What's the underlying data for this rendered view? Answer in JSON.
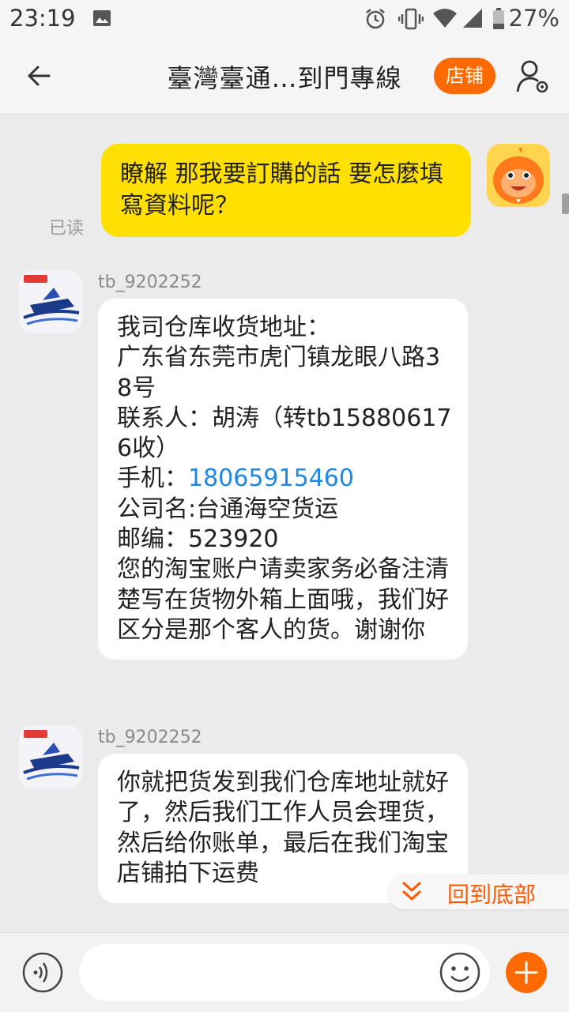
{
  "status_bar": {
    "time": "23:19",
    "battery": "27%",
    "icons": [
      "image-icon",
      "alarm-icon",
      "vibrate-icon",
      "wifi-icon",
      "signal-icon",
      "battery-icon"
    ]
  },
  "header": {
    "title": "臺灣臺通…到門專線",
    "shop_button": "店铺",
    "accent_color": "#ff6a00"
  },
  "messages": {
    "outgoing": {
      "text": "瞭解 那我要訂購的話 要怎麼填寫資料呢？",
      "read_status": "已读",
      "bubble_color": "#ffe000"
    },
    "incoming_1": {
      "sender": "tb_9202252",
      "lines": {
        "l1": "我司仓库收货地址：",
        "l2": "广东省东莞市虎门镇龙眼八路38号",
        "l3": "联系人：胡涛（转tb158806176收）",
        "l4_label": "手机：",
        "l4_phone": "18065915460",
        "l5": "公司名:台通海空货运",
        "l6": "邮编：523920",
        "l7": "您的淘宝账户请卖家务必备注清楚写在货物外箱上面哦，我们好区分是那个客人的货。谢谢你"
      },
      "link_color": "#1e88e5"
    },
    "incoming_2": {
      "sender": "tb_9202252",
      "text": "你就把货发到我们仓库地址就好了，然后我们工作人员会理货，然后给你账单，最后在我们淘宝店铺拍下运费"
    }
  },
  "jump_to_bottom": {
    "label": "回到底部"
  },
  "input_bar": {
    "placeholder": ""
  }
}
